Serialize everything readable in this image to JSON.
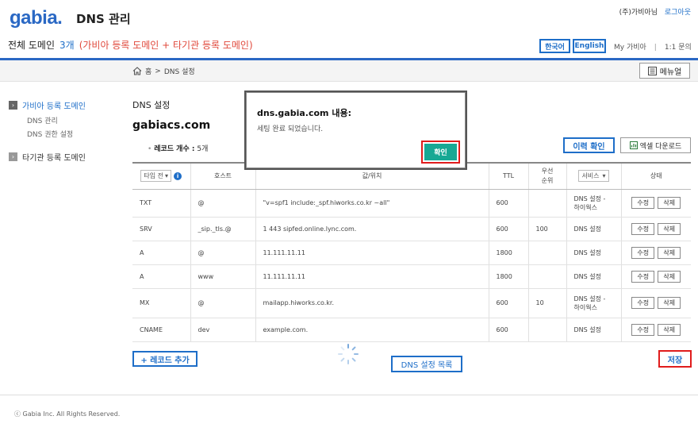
{
  "header": {
    "logo": "gabia.",
    "title": "DNS 관리",
    "user_label": "(주)가비아님",
    "logout": "로그아웃",
    "domain_all": "전체 도메인",
    "domain_count": "3개",
    "domain_note": "(가비아 등록 도메인 + 타기관 등록 도메인)",
    "lang_ko": "한국어",
    "lang_en": "English",
    "my_gabia": "My 가비아",
    "support": "1:1 문의"
  },
  "breadcrumb": {
    "home": "홈",
    "sep": ">",
    "current": "DNS 설정"
  },
  "menu_button": "메뉴얼",
  "sidebar": {
    "gabia_domains": "가비아 등록 도메인",
    "dns_manage": "DNS 관리",
    "dns_perm": "DNS 권한 설정",
    "other_domains": "타기관 등록 도메인"
  },
  "main": {
    "section_title": "DNS 설정",
    "domain": "gabiacs.com",
    "record_count_label": "레코드 개수 :",
    "record_count": "5개",
    "history_btn": "이력 확인",
    "excel_btn": "엑셀 다운로드",
    "add_record": "+ 레코드 추가",
    "dns_list": "DNS 설정 목록",
    "save": "저장"
  },
  "table": {
    "type_select": "타입 전",
    "headers": {
      "host": "호스트",
      "value": "값/위치",
      "ttl": "TTL",
      "priority": "우선\n순위",
      "service": "서비스",
      "status": "상태"
    },
    "edit": "수정",
    "delete": "삭제",
    "rows": [
      {
        "type": "TXT",
        "host": "@",
        "value": "\"v=spf1 include:_spf.hiworks.co.kr ~all\"",
        "ttl": "600",
        "priority": "",
        "service": "DNS 설정 -\n하이웍스"
      },
      {
        "type": "SRV",
        "host": "_sip._tls.@",
        "value": "1 443 sipfed.online.lync.com.",
        "ttl": "600",
        "priority": "100",
        "service": "DNS 설정"
      },
      {
        "type": "A",
        "host": "@",
        "value": "11.111.11.11",
        "ttl": "1800",
        "priority": "",
        "service": "DNS 설정"
      },
      {
        "type": "A",
        "host": "www",
        "value": "11.111.11.11",
        "ttl": "1800",
        "priority": "",
        "service": "DNS 설정"
      },
      {
        "type": "MX",
        "host": "@",
        "value": "mailapp.hiworks.co.kr.",
        "ttl": "600",
        "priority": "10",
        "service": "DNS 설정 -\n하이웍스"
      },
      {
        "type": "CNAME",
        "host": "dev",
        "value": "example.com.",
        "ttl": "600",
        "priority": "",
        "service": "DNS 설정"
      }
    ]
  },
  "dialog": {
    "title": "dns.gabia.com 내용:",
    "message": "세팅 완료 되었습니다.",
    "ok": "확인"
  },
  "footer": "ⓒ Gabia Inc. All Rights Reserved.",
  "colors": {
    "brand": "#2a68c4",
    "link": "#1e6ec8",
    "alert": "#e0483b",
    "highlight": "#e01c1c",
    "ok_button": "#17a894"
  }
}
